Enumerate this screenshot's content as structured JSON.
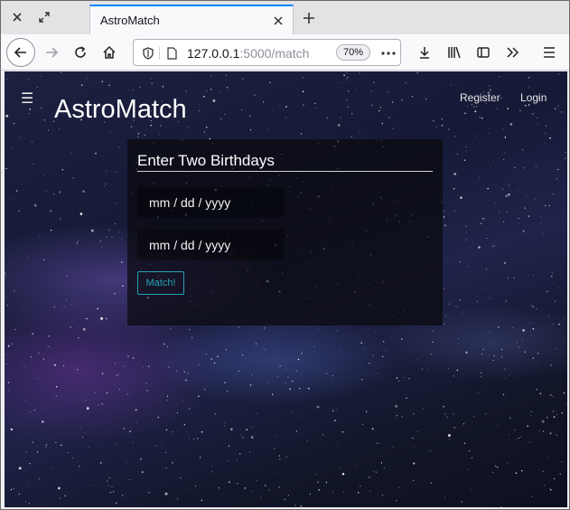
{
  "browser": {
    "tab_title": "AstroMatch",
    "url_host": "127.0.0.1",
    "url_path": ":5000/match",
    "zoom": "70%"
  },
  "site": {
    "title": "AstroMatch",
    "menu_icon": "hamburger-icon",
    "nav": {
      "register": "Register",
      "login": "Login"
    }
  },
  "form": {
    "heading": "Enter Two Birthdays",
    "birthday1_placeholder": "mm / dd / yyyy",
    "birthday2_placeholder": "mm / dd / yyyy",
    "submit_label": "Match!"
  },
  "colors": {
    "accent": "#26a3b5",
    "tab_highlight": "#0a84ff"
  }
}
